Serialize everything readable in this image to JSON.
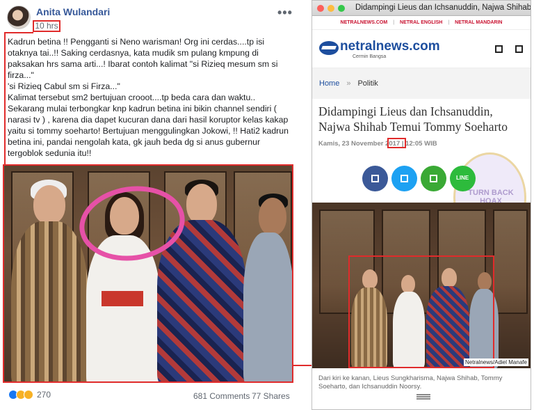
{
  "facebook_post": {
    "author": "Anita Wulandari",
    "timestamp": "10 hrs",
    "more_icon": "more-horizontal-icon",
    "body": "Kadrun betina !! Pengganti si Neno warisman! Org ini cerdas....tp isi otaknya tai..!! Saking cerdasnya, kata mudik sm pulang kmpung di paksakan hrs sama arti...! Ibarat contoh kalimat \"si Rizieq mesum sm si firza...\"\n'si Rizieq Cabul sm si Firza...\"\nKalimat tersebut sm2 bertujuan crooot....tp beda cara dan waktu..\nSekarang mulai terbongkar knp kadrun betina ini bikin channel sendiri ( narasi tv ) , karena dia dapet kucuran dana dari hasil koruptor kelas kakap yaitu si tommy soeharto! Bertujuan menggulingkan Jokowi, !! Hati2 kadrun betina ini, pandai nengolah kata, gk jauh beda dg si anus gubernur tergoblok sedunia itu!!",
    "watermark": "TURNBACKHOAX",
    "reactions_count": "270",
    "comments": "681 Comments",
    "shares": "77 Shares",
    "colors": {
      "name": "#365899",
      "highlight": "#e02b2b",
      "circle": "#e651a7"
    }
  },
  "browser": {
    "window_title": "Didampingi Lieus dan Ichsanuddin, Najwa Shihab Temu...",
    "top_nav": [
      "NETRALNEWS.COM",
      "NETRAL ENGLISH",
      "NETRAL MANDARIN"
    ],
    "top_nav_sep": "|",
    "logo_text": "netralnews.com",
    "logo_tagline": "Cermin Bangsa",
    "breadcrumb": {
      "home": "Home",
      "sep": "»",
      "category": "Politik"
    },
    "headline": "Didampingi Lieus dan Ichsanuddin, Najwa Shihab Temui Tommy Soeharto",
    "dateline": "Kamis, 23 November 2017 | 12:05 WIB",
    "share_buttons": [
      {
        "name": "facebook-share-icon",
        "color": "#3b5998"
      },
      {
        "name": "twitter-share-icon",
        "color": "#1da1f2"
      },
      {
        "name": "whatsapp-share-icon",
        "color": "#3aa935"
      },
      {
        "name": "line-share-icon",
        "color": "#2dbb3c",
        "label": "LINE"
      }
    ],
    "stamp_text": "TURN BACK HOAX",
    "photo_credit": "Netralnews/Adiel Manafe",
    "caption": "Dari kiri ke kanan, Lieus Sungkharisma, Najwa Shihab, Tommy Soeharto, dan Ichsanuddin Noorsy."
  }
}
